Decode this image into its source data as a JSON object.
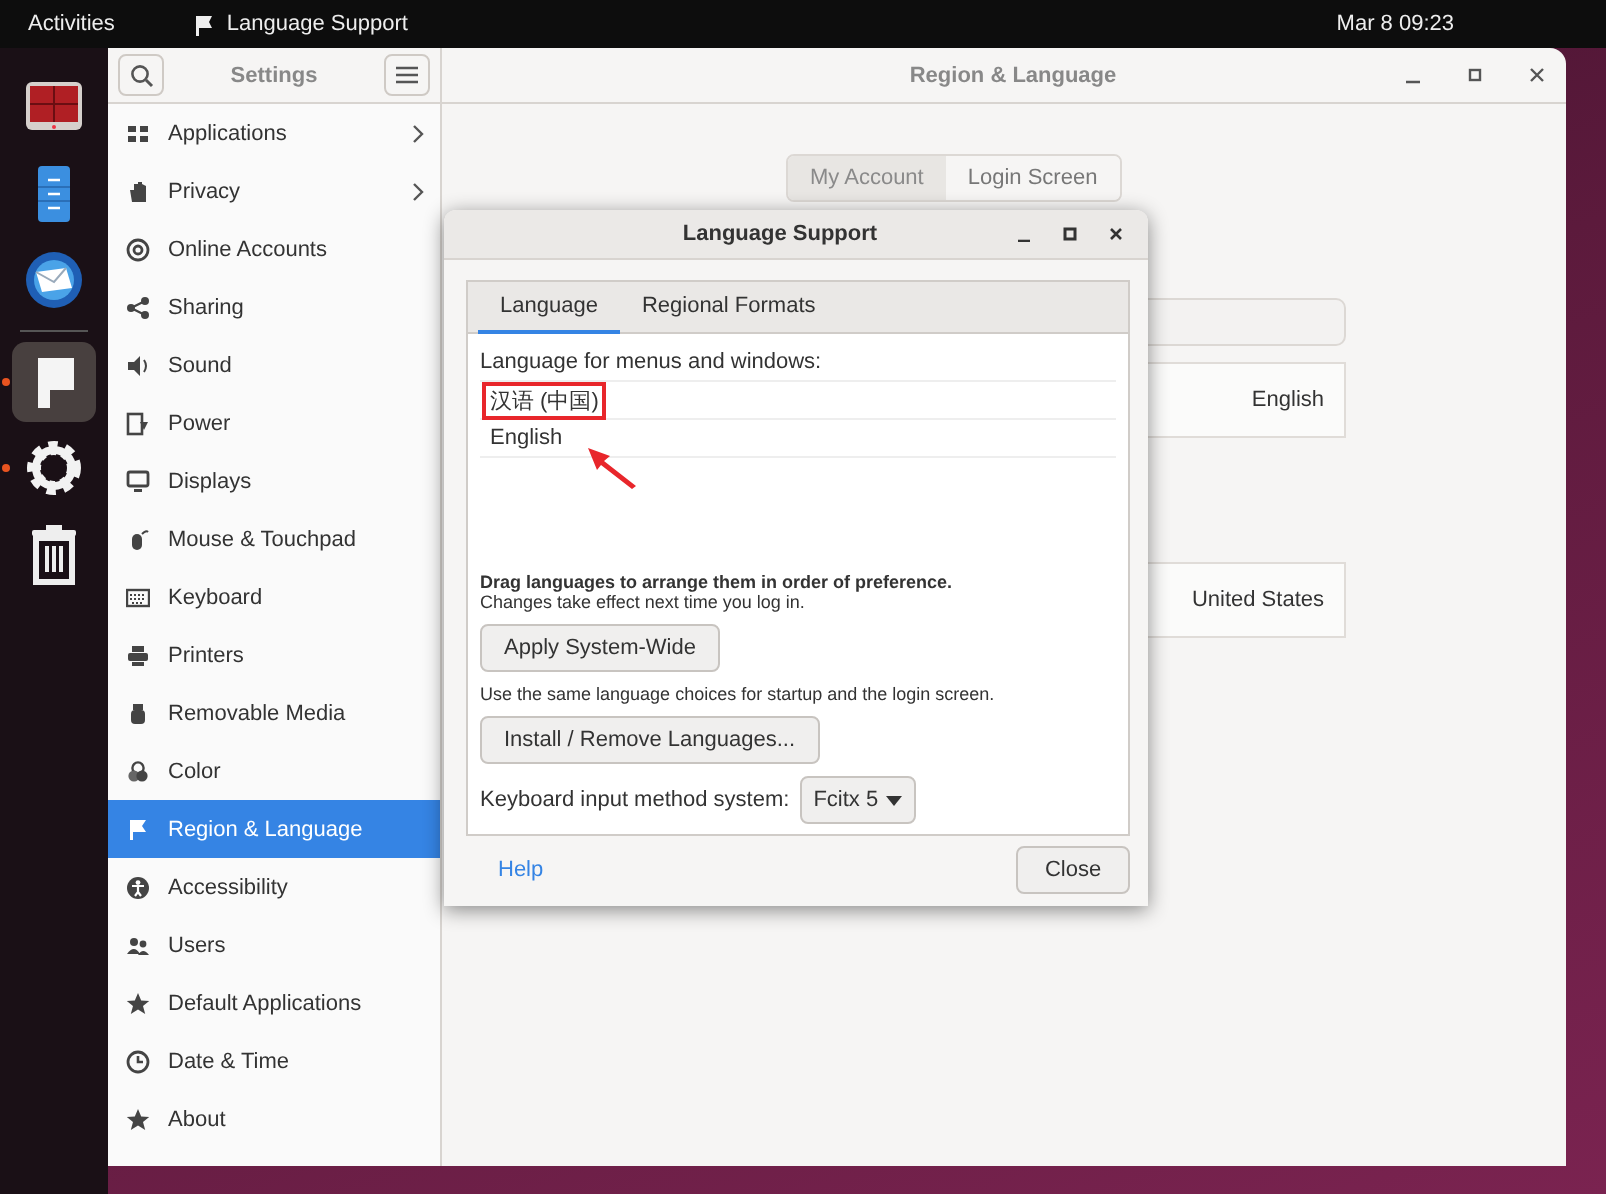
{
  "top_bar": {
    "activities": "Activities",
    "app_name": "Language Support",
    "clock": "Mar 8  09:23"
  },
  "dock": [
    {
      "kind": "terminal",
      "running": false,
      "selected": false
    },
    {
      "kind": "files",
      "running": false,
      "selected": false
    },
    {
      "kind": "mail",
      "running": false,
      "selected": false
    },
    {
      "kind": "flag",
      "running": true,
      "selected": true
    },
    {
      "kind": "gear",
      "running": true,
      "selected": false
    },
    {
      "kind": "trash",
      "running": false,
      "selected": false
    }
  ],
  "settings_window": {
    "sidebar_title": "Settings",
    "title": "Region & Language",
    "sidebar": {
      "items": [
        {
          "label": "Applications",
          "kind": "apps",
          "submenu": true,
          "selected": false
        },
        {
          "label": "Privacy",
          "kind": "hand",
          "submenu": true,
          "selected": false
        },
        {
          "label": "Online Accounts",
          "kind": "at",
          "submenu": false,
          "selected": false
        },
        {
          "label": "Sharing",
          "kind": "share",
          "submenu": false,
          "selected": false
        },
        {
          "label": "Sound",
          "kind": "speaker",
          "submenu": false,
          "selected": false
        },
        {
          "label": "Power",
          "kind": "power",
          "submenu": false,
          "selected": false
        },
        {
          "label": "Displays",
          "kind": "monitor",
          "submenu": false,
          "selected": false
        },
        {
          "label": "Mouse & Touchpad",
          "kind": "mouse",
          "submenu": false,
          "selected": false
        },
        {
          "label": "Keyboard",
          "kind": "keyboard",
          "submenu": false,
          "selected": false
        },
        {
          "label": "Printers",
          "kind": "printer",
          "submenu": false,
          "selected": false
        },
        {
          "label": "Removable Media",
          "kind": "usb",
          "submenu": false,
          "selected": false
        },
        {
          "label": "Color",
          "kind": "color",
          "submenu": false,
          "selected": false
        },
        {
          "label": "Region & Language",
          "kind": "flag",
          "submenu": false,
          "selected": true
        },
        {
          "label": "Accessibility",
          "kind": "person",
          "submenu": false,
          "selected": false
        },
        {
          "label": "Users",
          "kind": "users",
          "submenu": false,
          "selected": false
        },
        {
          "label": "Default Applications",
          "kind": "star",
          "submenu": false,
          "selected": false
        },
        {
          "label": "Date & Time",
          "kind": "clock",
          "submenu": false,
          "selected": false
        },
        {
          "label": "About",
          "kind": "star",
          "submenu": false,
          "selected": false
        }
      ]
    },
    "mode_tabs": [
      {
        "label": "My Account",
        "selected": true
      },
      {
        "label": "Login Screen",
        "selected": false
      }
    ],
    "rows": [
      {
        "kind": "field"
      },
      {
        "kind": "value",
        "value": "English"
      },
      {
        "kind": "value",
        "value": "United States"
      }
    ]
  },
  "dialog": {
    "title": "Language Support",
    "tabs": [
      {
        "label": "Language",
        "selected": true
      },
      {
        "label": "Regional Formats",
        "selected": false
      }
    ],
    "list_label": "Language for menus and windows:",
    "languages": [
      {
        "label": "汉语 (中国)",
        "annotated": true
      },
      {
        "label": "English",
        "annotated": false
      }
    ],
    "drag_hint": "Drag languages to arrange them in order of preference.",
    "drag_note": "Changes take effect next time you log in.",
    "apply_button": "Apply System-Wide",
    "apply_note": "Use the same language choices for startup and the login screen.",
    "install_button": "Install / Remove Languages...",
    "input_method_label": "Keyboard input method system:",
    "input_method": "Fcitx 5",
    "help_link": "Help",
    "close_button": "Close"
  }
}
